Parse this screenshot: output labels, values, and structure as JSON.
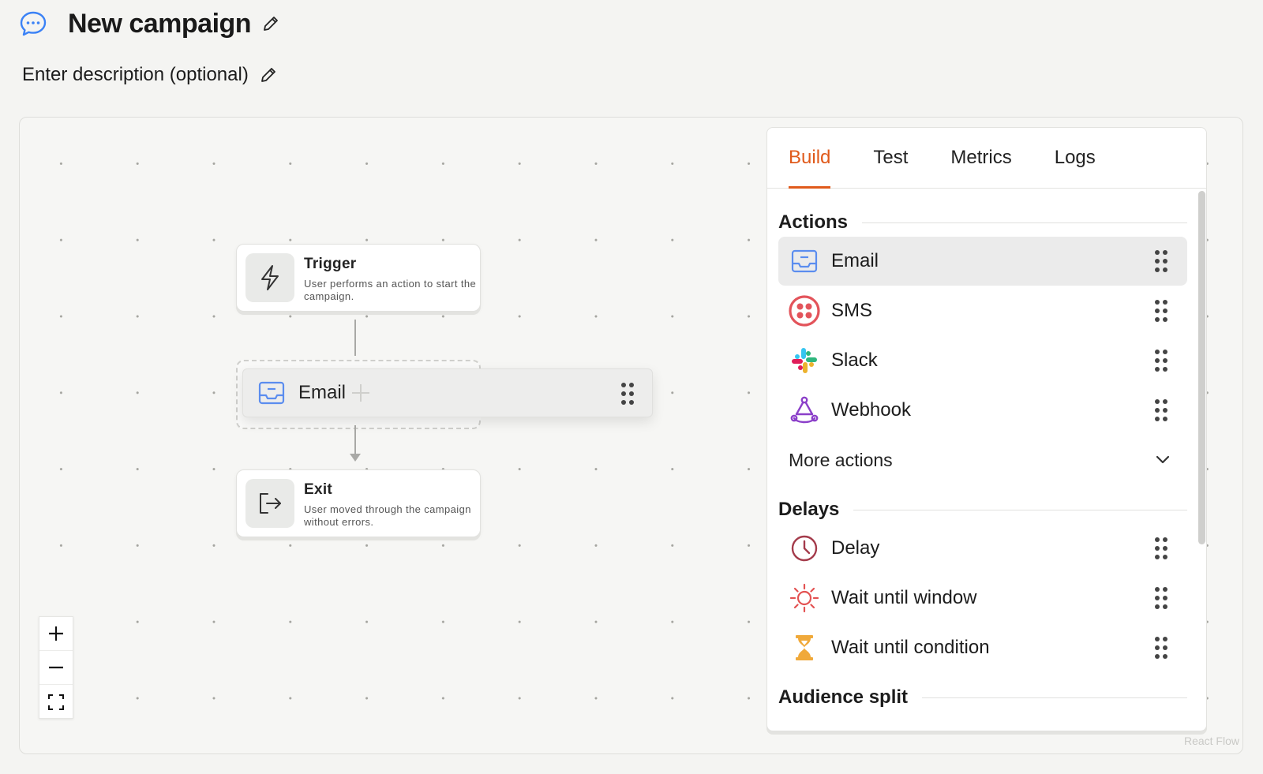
{
  "header": {
    "title": "New campaign",
    "description": "Enter description (optional)"
  },
  "flow": {
    "trigger": {
      "title": "Trigger",
      "subtitle": "User performs an action to start the campaign."
    },
    "dragging": {
      "label": "Email"
    },
    "exit": {
      "title": "Exit",
      "subtitle": "User moved through the campaign without errors."
    }
  },
  "zoom": {
    "in": "+",
    "out": "−"
  },
  "attribution": "React Flow",
  "panel": {
    "tabs": [
      "Build",
      "Test",
      "Metrics",
      "Logs"
    ],
    "active_tab": "Build",
    "sections": {
      "actions": {
        "title": "Actions",
        "items": [
          "Email",
          "SMS",
          "Slack",
          "Webhook"
        ],
        "more": "More actions"
      },
      "delays": {
        "title": "Delays",
        "items": [
          "Delay",
          "Wait until window",
          "Wait until condition"
        ]
      },
      "audience": {
        "title": "Audience split"
      }
    }
  },
  "colors": {
    "accent": "#e05a1b",
    "chat_icon": "#3b82f6",
    "email_icon": "#5b8def",
    "sms_icon": "#e3545b",
    "webhook_icon": "#8b3fc9",
    "delay_icon": "#a43b4b",
    "window_icon": "#e35252",
    "condition_icon": "#f0a93a"
  }
}
